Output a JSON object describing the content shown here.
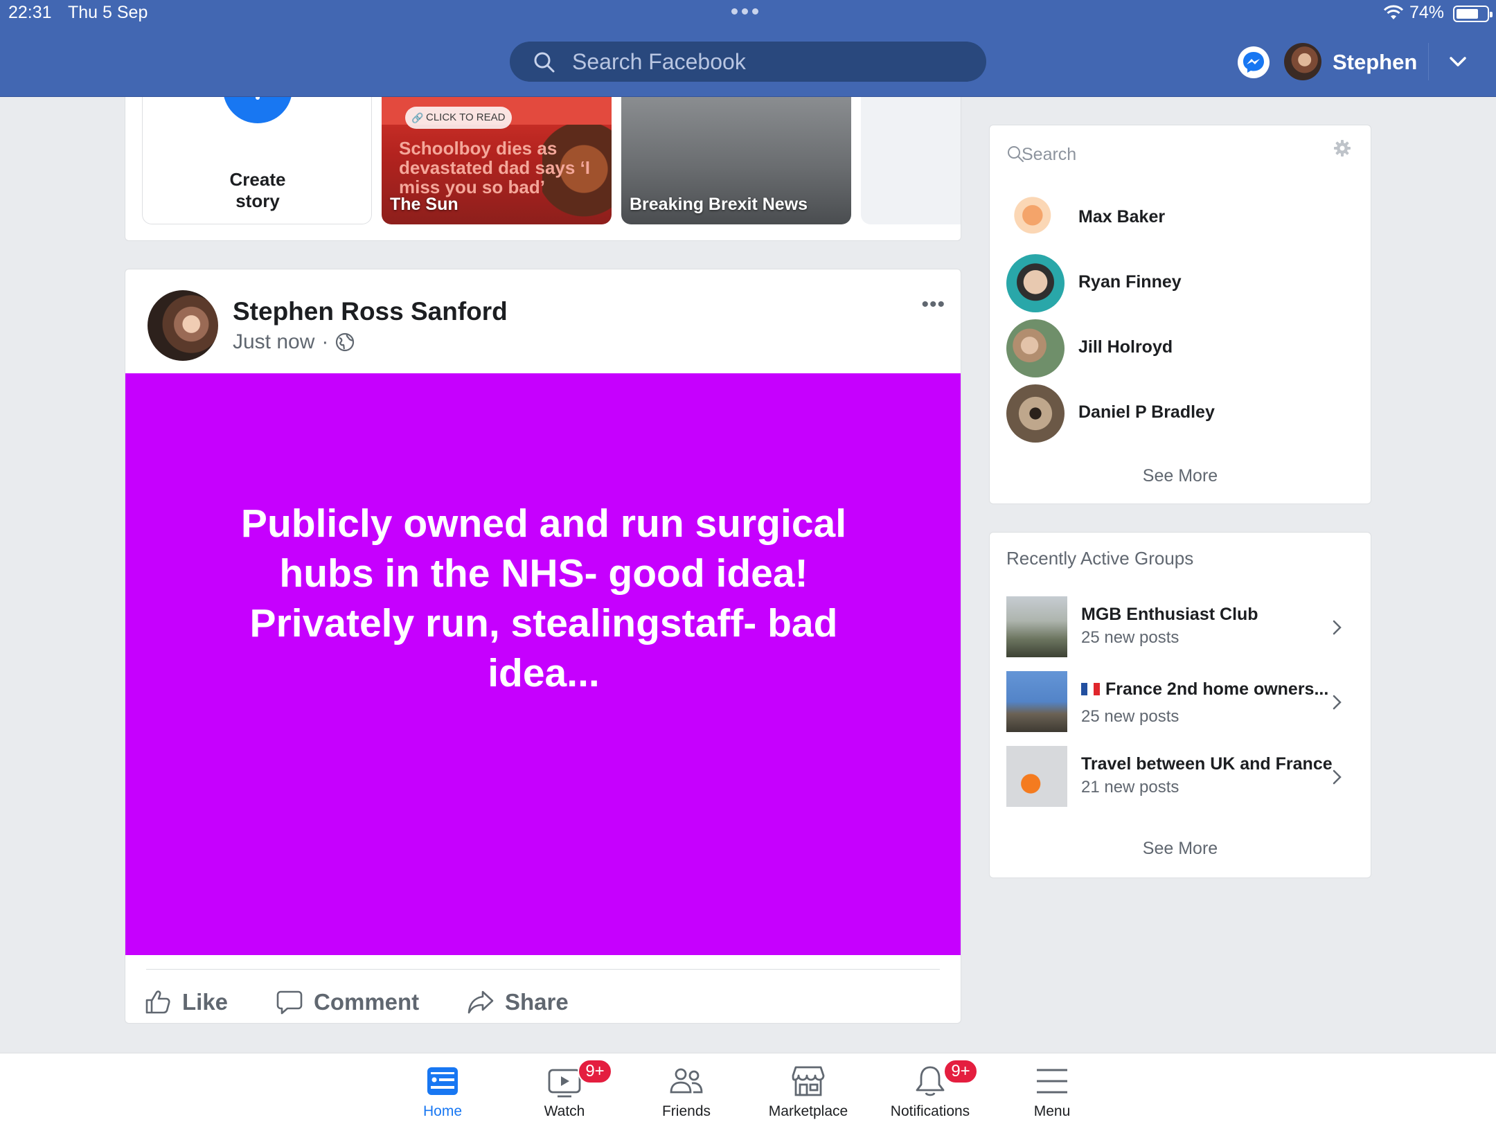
{
  "status_bar": {
    "time": "22:31",
    "date": "Thu 5 Sep",
    "battery": "74%",
    "battery_level": 0.74
  },
  "header": {
    "search_placeholder": "Search Facebook",
    "username": "Stephen"
  },
  "stories": {
    "create_label": "Create story",
    "items": [
      {
        "source": "The Sun",
        "badge": "CLICK TO READ",
        "headline": "Schoolboy dies as devastated dad says ‘I miss you so bad’"
      },
      {
        "source": "Breaking Brexit News"
      }
    ]
  },
  "post": {
    "author": "Stephen Ross Sanford",
    "time": "Just now",
    "more": "•••",
    "text": "Publicly owned and run surgical hubs in the NHS- good idea! Privately run, stealingstaff- bad idea...",
    "background_color": "#c600fe",
    "actions": {
      "like": "Like",
      "comment": "Comment",
      "share": "Share"
    }
  },
  "contacts": {
    "search_placeholder": "Search",
    "items": [
      {
        "name": "Max Baker"
      },
      {
        "name": "Ryan Finney"
      },
      {
        "name": "Jill Holroyd"
      },
      {
        "name": "Daniel P Bradley"
      }
    ],
    "see_more": "See More"
  },
  "groups": {
    "title": "Recently Active Groups",
    "items": [
      {
        "name": "MGB Enthusiast Club",
        "posts": "25 new posts"
      },
      {
        "name": "France 2nd home owners...",
        "posts": "25 new posts"
      },
      {
        "name": "Travel between UK and France",
        "posts": "21 new posts"
      }
    ],
    "see_more": "See More"
  },
  "tabbar": {
    "items": [
      {
        "label": "Home",
        "icon": "home-icon",
        "active": true
      },
      {
        "label": "Watch",
        "icon": "watch-icon",
        "badge": "9+"
      },
      {
        "label": "Friends",
        "icon": "friends-icon"
      },
      {
        "label": "Marketplace",
        "icon": "marketplace-icon"
      },
      {
        "label": "Notifications",
        "icon": "bell-icon",
        "badge": "9+"
      },
      {
        "label": "Menu",
        "icon": "menu-icon"
      }
    ]
  },
  "colors": {
    "header_blue": "#4267b2",
    "accent": "#1877f2",
    "badge_red": "#e41e3f",
    "post_purple": "#c600fe"
  }
}
